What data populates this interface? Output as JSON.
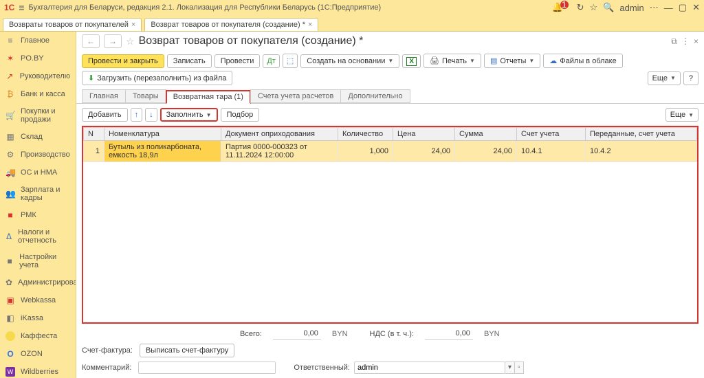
{
  "app": {
    "logo": "1C",
    "title": "Бухгалтерия для Беларуси, редакция 2.1. Локализация для Республики Беларусь  (1С:Предприятие)",
    "notif_count": "1",
    "user": "admin"
  },
  "tabs": [
    {
      "label": "Возвраты товаров от покупателей"
    },
    {
      "label": "Возврат товаров от покупателя (создание) *"
    }
  ],
  "sidebar": {
    "items": [
      {
        "icon": "≡",
        "label": "Главное",
        "cls": "ic-gray"
      },
      {
        "icon": "✶",
        "label": "PO.BY",
        "cls": "ic-red"
      },
      {
        "icon": "↗",
        "label": "Руководителю",
        "cls": "ic-red"
      },
      {
        "icon": "₿",
        "label": "Банк и касса",
        "cls": "ic-orange"
      },
      {
        "icon": "🛒",
        "label": "Покупки и продажи",
        "cls": "ic-gray"
      },
      {
        "icon": "▦",
        "label": "Склад",
        "cls": "ic-gray"
      },
      {
        "icon": "⚙",
        "label": "Производство",
        "cls": "ic-gray"
      },
      {
        "icon": "🚚",
        "label": "ОС и НМА",
        "cls": "ic-gray"
      },
      {
        "icon": "👥",
        "label": "Зарплата и кадры",
        "cls": "ic-red"
      },
      {
        "icon": "■",
        "label": "РМК",
        "cls": "ic-red"
      },
      {
        "icon": "Δ",
        "label": "Налоги и отчетность",
        "cls": "ic-blue"
      },
      {
        "icon": "■",
        "label": "Настройки учета",
        "cls": "ic-gray"
      },
      {
        "icon": "✿",
        "label": "Администрирование",
        "cls": "ic-gray"
      },
      {
        "icon": "▣",
        "label": "Webkassa",
        "cls": "ic-red"
      },
      {
        "icon": "◧",
        "label": "iKassa",
        "cls": "ic-gray"
      },
      {
        "icon": "",
        "label": "Каффеста",
        "cls": "kaf"
      },
      {
        "icon": "O",
        "label": "OZON",
        "cls": "ozon"
      },
      {
        "icon": "W",
        "label": "Wildberries",
        "cls": "wb"
      }
    ]
  },
  "page": {
    "title": "Возврат товаров от покупателя (создание) *"
  },
  "toolbar": {
    "post_close": "Провести и закрыть",
    "save": "Записать",
    "post": "Провести",
    "create_based": "Создать на основании",
    "print": "Печать",
    "reports": "Отчеты",
    "files": "Файлы в облаке",
    "load": "Загрузить (перезаполнить) из файла",
    "more": "Еще",
    "help": "?"
  },
  "subtabs": {
    "main": "Главная",
    "goods": "Товары",
    "tare": "Возвратная тара (1)",
    "accounts": "Счета учета расчетов",
    "extra": "Дополнительно"
  },
  "minitb": {
    "add": "Добавить",
    "fill": "Заполнить",
    "pick": "Подбор",
    "more": "Еще"
  },
  "table": {
    "cols": {
      "n": "N",
      "nom": "Номенклатура",
      "doc": "Документ оприходования",
      "qty": "Количество",
      "price": "Цена",
      "sum": "Сумма",
      "acc": "Счет учета",
      "acc2": "Переданные, счет учета"
    },
    "rows": [
      {
        "n": "1",
        "nom": "Бутыль из поликарбоната, емкость 18,9л",
        "doc": "Партия 0000-000323 от 11.11.2024 12:00:00",
        "qty": "1,000",
        "price": "24,00",
        "sum": "24,00",
        "acc": "10.4.1",
        "acc2": "10.4.2"
      }
    ]
  },
  "footer": {
    "total_lbl": "Всего:",
    "total_val": "0,00",
    "cur": "BYN",
    "vat_lbl": "НДС (в т. ч.):",
    "vat_val": "0,00",
    "invoice_lbl": "Счет-фактура:",
    "invoice_btn": "Выписать счет-фактуру",
    "comment_lbl": "Комментарий:",
    "resp_lbl": "Ответственный:",
    "resp_val": "admin"
  }
}
